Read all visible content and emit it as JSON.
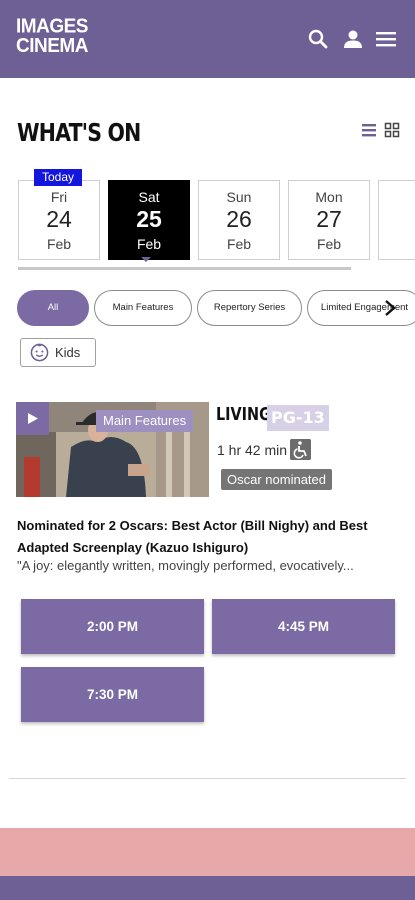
{
  "header": {
    "logo_line1": "IMAGES",
    "logo_line2": "CINEMA",
    "icons": [
      "search-icon",
      "account-icon",
      "menu-icon"
    ]
  },
  "page": {
    "title": "WHAT'S ON",
    "view_icons": [
      "list-view-icon",
      "grid-view-icon"
    ]
  },
  "dates": {
    "today_label": "Today",
    "items": [
      {
        "dow": "Fri",
        "day": "24",
        "mon": "Feb",
        "selected": false
      },
      {
        "dow": "Sat",
        "day": "25",
        "mon": "Feb",
        "selected": true
      },
      {
        "dow": "Sun",
        "day": "26",
        "mon": "Feb",
        "selected": false
      },
      {
        "dow": "Mon",
        "day": "27",
        "mon": "Feb",
        "selected": false
      }
    ]
  },
  "filters": {
    "chips": [
      "All",
      "Main Features",
      "Repertory Series",
      "Limited Engagement"
    ],
    "active": "All",
    "kids_label": "Kids"
  },
  "movie": {
    "category_tag": "Main Features",
    "title": "LIVING",
    "rating": "PG-13",
    "runtime": "1 hr 42 min",
    "badge": "Oscar nominated",
    "headline": "Nominated for 2 Oscars: Best Actor (Bill Nighy) and Best Adapted Screenplay (Kazuo Ishiguro)",
    "blurb": "\"A joy: elegantly written, movingly performed, evocatively...",
    "showtimes": [
      "2:00 PM",
      "4:45 PM",
      "7:30 PM"
    ]
  },
  "colors": {
    "brand_purple": "#6e5f94",
    "button_purple": "#7b6aa3",
    "today_blue": "#1515e0",
    "footer_pink": "#e6a8a8"
  }
}
